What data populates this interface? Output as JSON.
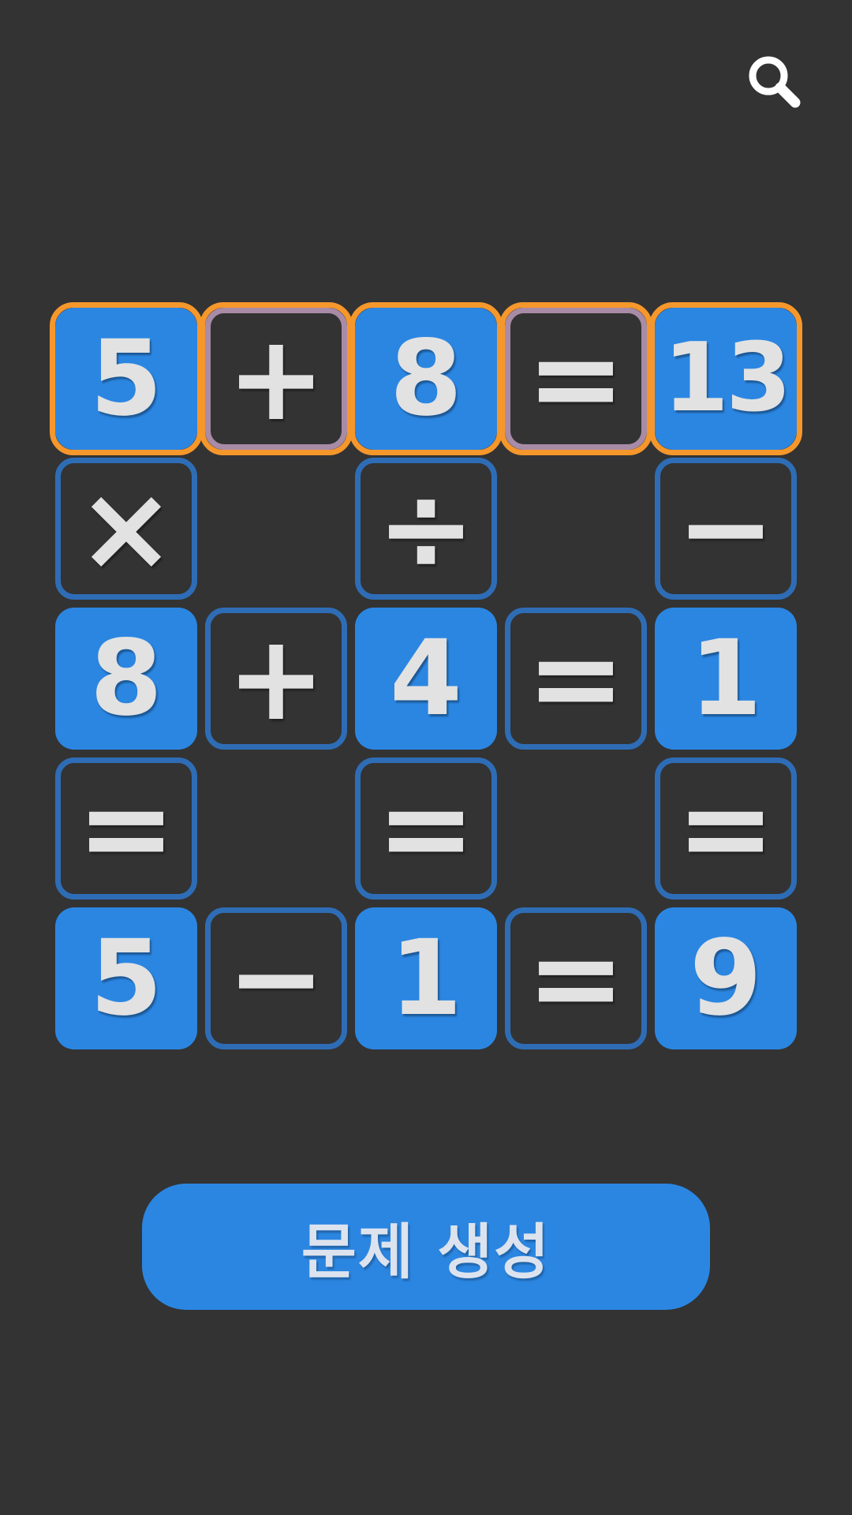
{
  "header": {
    "search_icon": "search-icon"
  },
  "puzzle": {
    "rows": [
      [
        {
          "kind": "num",
          "value": "5"
        },
        {
          "kind": "op",
          "value": "+"
        },
        {
          "kind": "num",
          "value": "8"
        },
        {
          "kind": "op",
          "value": "="
        },
        {
          "kind": "num",
          "value": "13"
        }
      ],
      [
        {
          "kind": "op",
          "value": "×"
        },
        {
          "kind": "empty",
          "value": ""
        },
        {
          "kind": "op",
          "value": "÷"
        },
        {
          "kind": "empty",
          "value": ""
        },
        {
          "kind": "op",
          "value": "−"
        }
      ],
      [
        {
          "kind": "num",
          "value": "8"
        },
        {
          "kind": "op",
          "value": "+"
        },
        {
          "kind": "num",
          "value": "4"
        },
        {
          "kind": "op",
          "value": "="
        },
        {
          "kind": "num",
          "value": "1"
        }
      ],
      [
        {
          "kind": "op",
          "value": "="
        },
        {
          "kind": "empty",
          "value": ""
        },
        {
          "kind": "op",
          "value": "="
        },
        {
          "kind": "empty",
          "value": ""
        },
        {
          "kind": "op",
          "value": "="
        }
      ],
      [
        {
          "kind": "num",
          "value": "5"
        },
        {
          "kind": "op",
          "value": "−"
        },
        {
          "kind": "num",
          "value": "1"
        },
        {
          "kind": "op",
          "value": "="
        },
        {
          "kind": "num",
          "value": "9"
        }
      ]
    ],
    "highlighted_row": 0
  },
  "actions": {
    "generate_label": "문제 생성"
  },
  "colors": {
    "background": "#333333",
    "number_tile": "#2B86E2",
    "operator_border": "#2E6DB6",
    "highlight": "#F6972C",
    "selected_operator_border": "#A88BA6",
    "text": "#E2E2E2"
  }
}
